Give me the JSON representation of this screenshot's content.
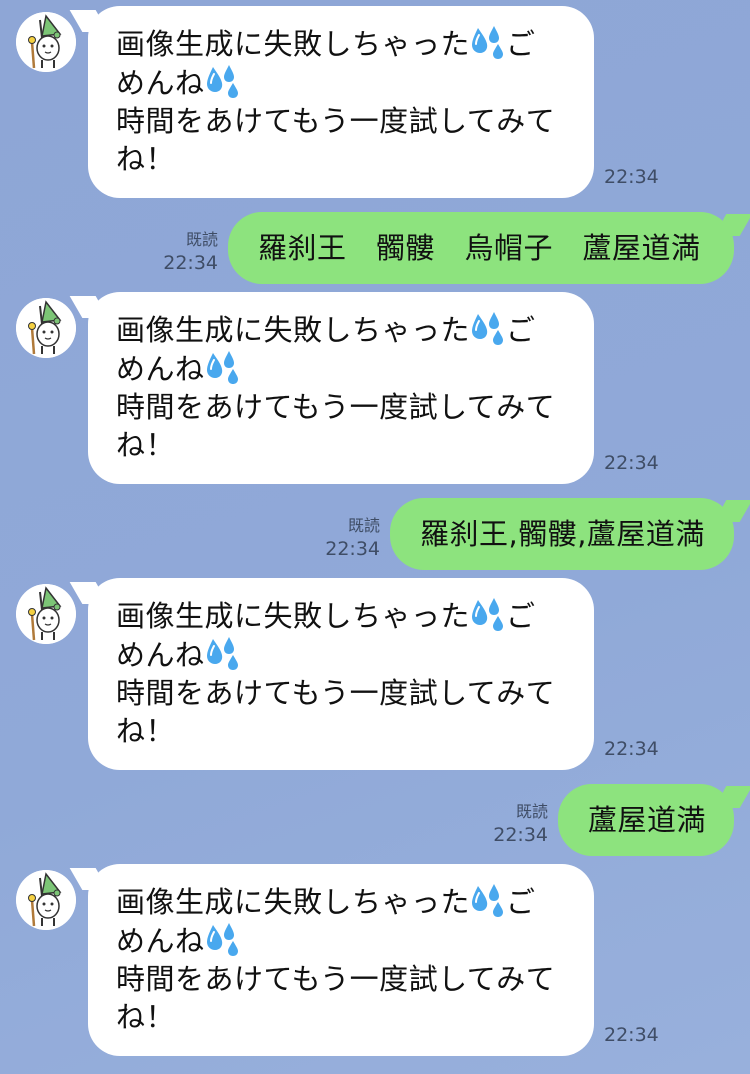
{
  "bot": {
    "avatar_icon": "rabbit-wizard-avatar",
    "message_prefix": "画像生成に失敗しちゃった",
    "message_emoji": "sweat-droplets-icon",
    "message_after_emoji": "ご",
    "message_line2_prefix": "めんね",
    "message_line3": "時間をあけてもう一度試してみて",
    "message_line4": "ね！"
  },
  "messages": [
    {
      "type": "incoming",
      "time": "22:34"
    },
    {
      "type": "outgoing",
      "text": "羅刹王　髑髏　烏帽子　蘆屋道満",
      "read": "既読",
      "time": "22:34"
    },
    {
      "type": "incoming",
      "time": "22:34"
    },
    {
      "type": "outgoing",
      "text": "羅刹王,髑髏,蘆屋道満",
      "read": "既読",
      "time": "22:34"
    },
    {
      "type": "incoming",
      "time": "22:34"
    },
    {
      "type": "outgoing",
      "text": "蘆屋道満",
      "read": "既読",
      "time": "22:34"
    },
    {
      "type": "incoming",
      "time": "22:34"
    }
  ],
  "colors": {
    "background": "#8fa8d6",
    "outgoing_bubble": "#8de37e",
    "incoming_bubble": "#ffffff",
    "meta_text": "#3f4d66",
    "droplet": "#3a9ee6"
  }
}
